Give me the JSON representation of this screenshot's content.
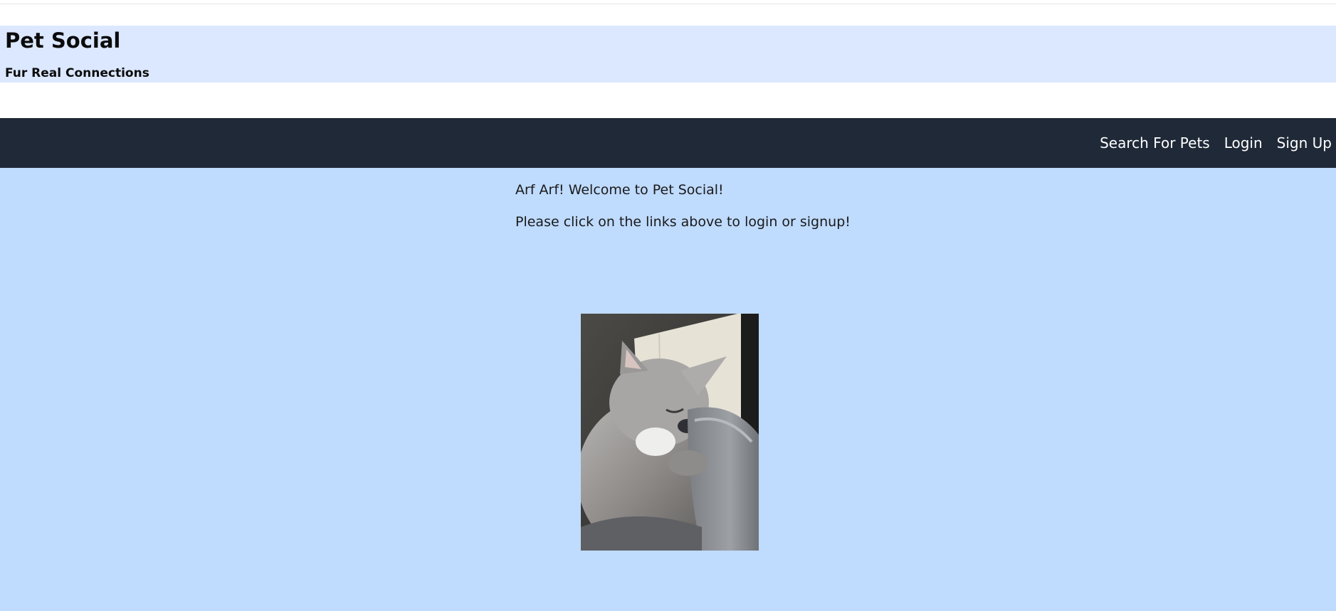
{
  "header": {
    "title": "Pet Social",
    "tagline": "Fur Real Connections"
  },
  "nav": {
    "items": [
      {
        "label": "Search For Pets"
      },
      {
        "label": "Login"
      },
      {
        "label": "Sign Up"
      }
    ]
  },
  "main": {
    "welcome": "Arf Arf! Welcome to Pet Social!",
    "instruction": "Please click on the links above to login or signup!",
    "image": {
      "subject": "sleeping-gray-cat-photo"
    }
  },
  "colors": {
    "header_band": "#dbe8ff",
    "navbar": "#1f2937",
    "nav_text": "#ffffff",
    "main_background": "#bfdbfe",
    "body_text": "#1a1a1a"
  }
}
